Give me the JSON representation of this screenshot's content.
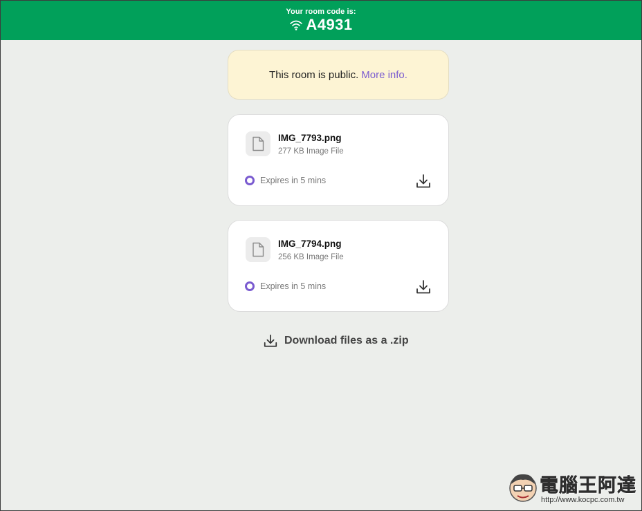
{
  "header": {
    "caption": "Your room code is:",
    "room_code": "A4931",
    "icon": "wifi-icon",
    "color": "#01a05a"
  },
  "notice": {
    "text": "This room is public.",
    "link": "More info.",
    "background": "#fdf4d4",
    "link_color": "#7a5bd0"
  },
  "files": [
    {
      "name": "IMG_7793.png",
      "meta": "277 KB Image File",
      "expiry": "Expires in 5 mins"
    },
    {
      "name": "IMG_7794.png",
      "meta": "256 KB Image File",
      "expiry": "Expires in 5 mins"
    }
  ],
  "zip_download": {
    "label": "Download files as a .zip",
    "icon": "download-icon"
  },
  "watermark": {
    "title": "電腦王阿達",
    "url": "http://www.kocpc.com.tw"
  }
}
